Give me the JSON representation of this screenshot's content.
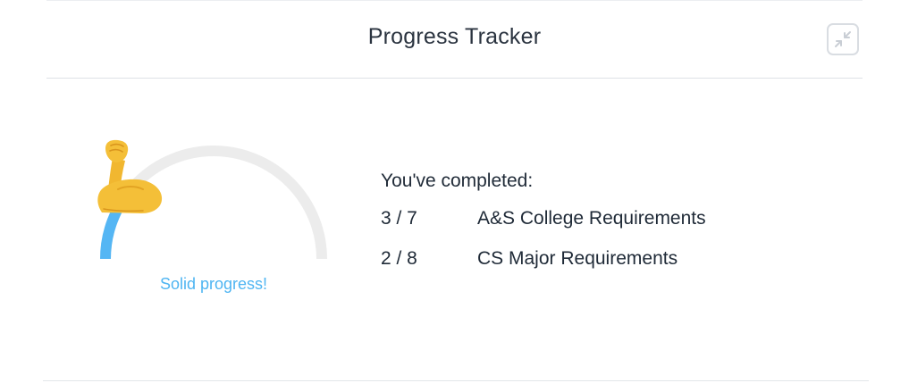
{
  "header": {
    "title": "Progress Tracker",
    "collapse_icon": "minimize-arrows-icon"
  },
  "gauge": {
    "progress_fraction": 0.23,
    "emoji_icon": "flexed-biceps-icon",
    "caption": "Solid progress!",
    "colors": {
      "fill": "#55b6f4",
      "track": "#ececec",
      "caption": "#4fb5f2"
    }
  },
  "summary": {
    "heading": "You've completed:",
    "requirements": [
      {
        "count": "3 / 7",
        "label": "A&S College Requirements"
      },
      {
        "count": "2 / 8",
        "label": "CS Major Requirements"
      }
    ]
  }
}
